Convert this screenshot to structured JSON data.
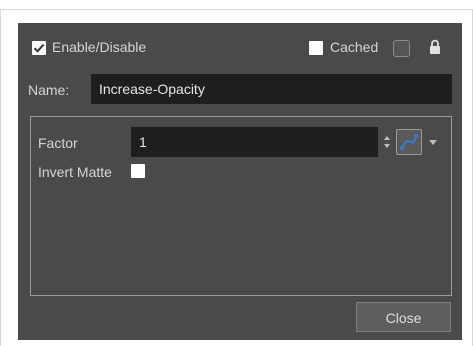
{
  "dialog": {
    "enable_disable": {
      "label": "Enable/Disable",
      "checked": true
    },
    "cached": {
      "label": "Cached",
      "checked": false
    },
    "icons": [
      "checkbox-icon",
      "lock-icon",
      "function-curve-icon",
      "spinner-arrows-icon",
      "dropdown-arrow-icon"
    ],
    "name": {
      "label": "Name:",
      "value": "Increase-Opacity"
    },
    "parameters": {
      "factor": {
        "label": "Factor",
        "value": "1"
      },
      "invert_matte": {
        "label": "Invert Matte",
        "checked": false
      }
    },
    "close_label": "Close"
  },
  "colors": {
    "panel": "#4a4a4a",
    "field": "#1e1e1e",
    "text": "#d4d4d4",
    "accent": "#3a7bd5"
  }
}
